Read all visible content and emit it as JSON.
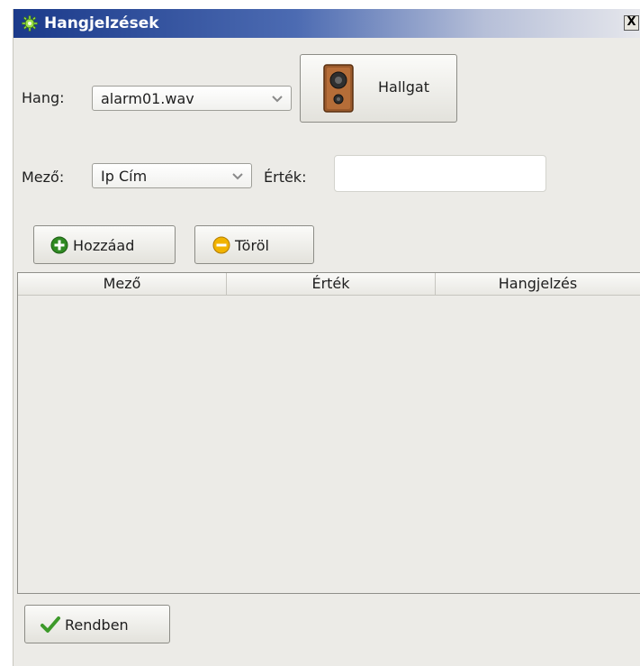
{
  "window": {
    "title": "Hangjelzések",
    "close_glyph": "X"
  },
  "sound": {
    "label": "Hang:",
    "selected": "alarm01.wav",
    "listen_label": "Hallgat"
  },
  "field": {
    "label": "Mező:",
    "selected": "Ip Cím",
    "value_label": "Érték:",
    "value": ""
  },
  "actions": {
    "add_label": "Hozzáad",
    "delete_label": "Töröl"
  },
  "table": {
    "columns": [
      "Mező",
      "Érték",
      "Hangjelzés"
    ],
    "rows": []
  },
  "footer": {
    "ok_label": "Rendben"
  },
  "colors": {
    "titlebar_start": "#1b3a8a",
    "add_icon": "#2f8a22",
    "delete_icon": "#e8a800",
    "check_icon": "#3d9a2a"
  },
  "icons": [
    "gear-icon",
    "close-icon",
    "chevron-down-icon",
    "speaker-icon",
    "plus-circle-icon",
    "minus-circle-icon",
    "checkmark-icon"
  ]
}
